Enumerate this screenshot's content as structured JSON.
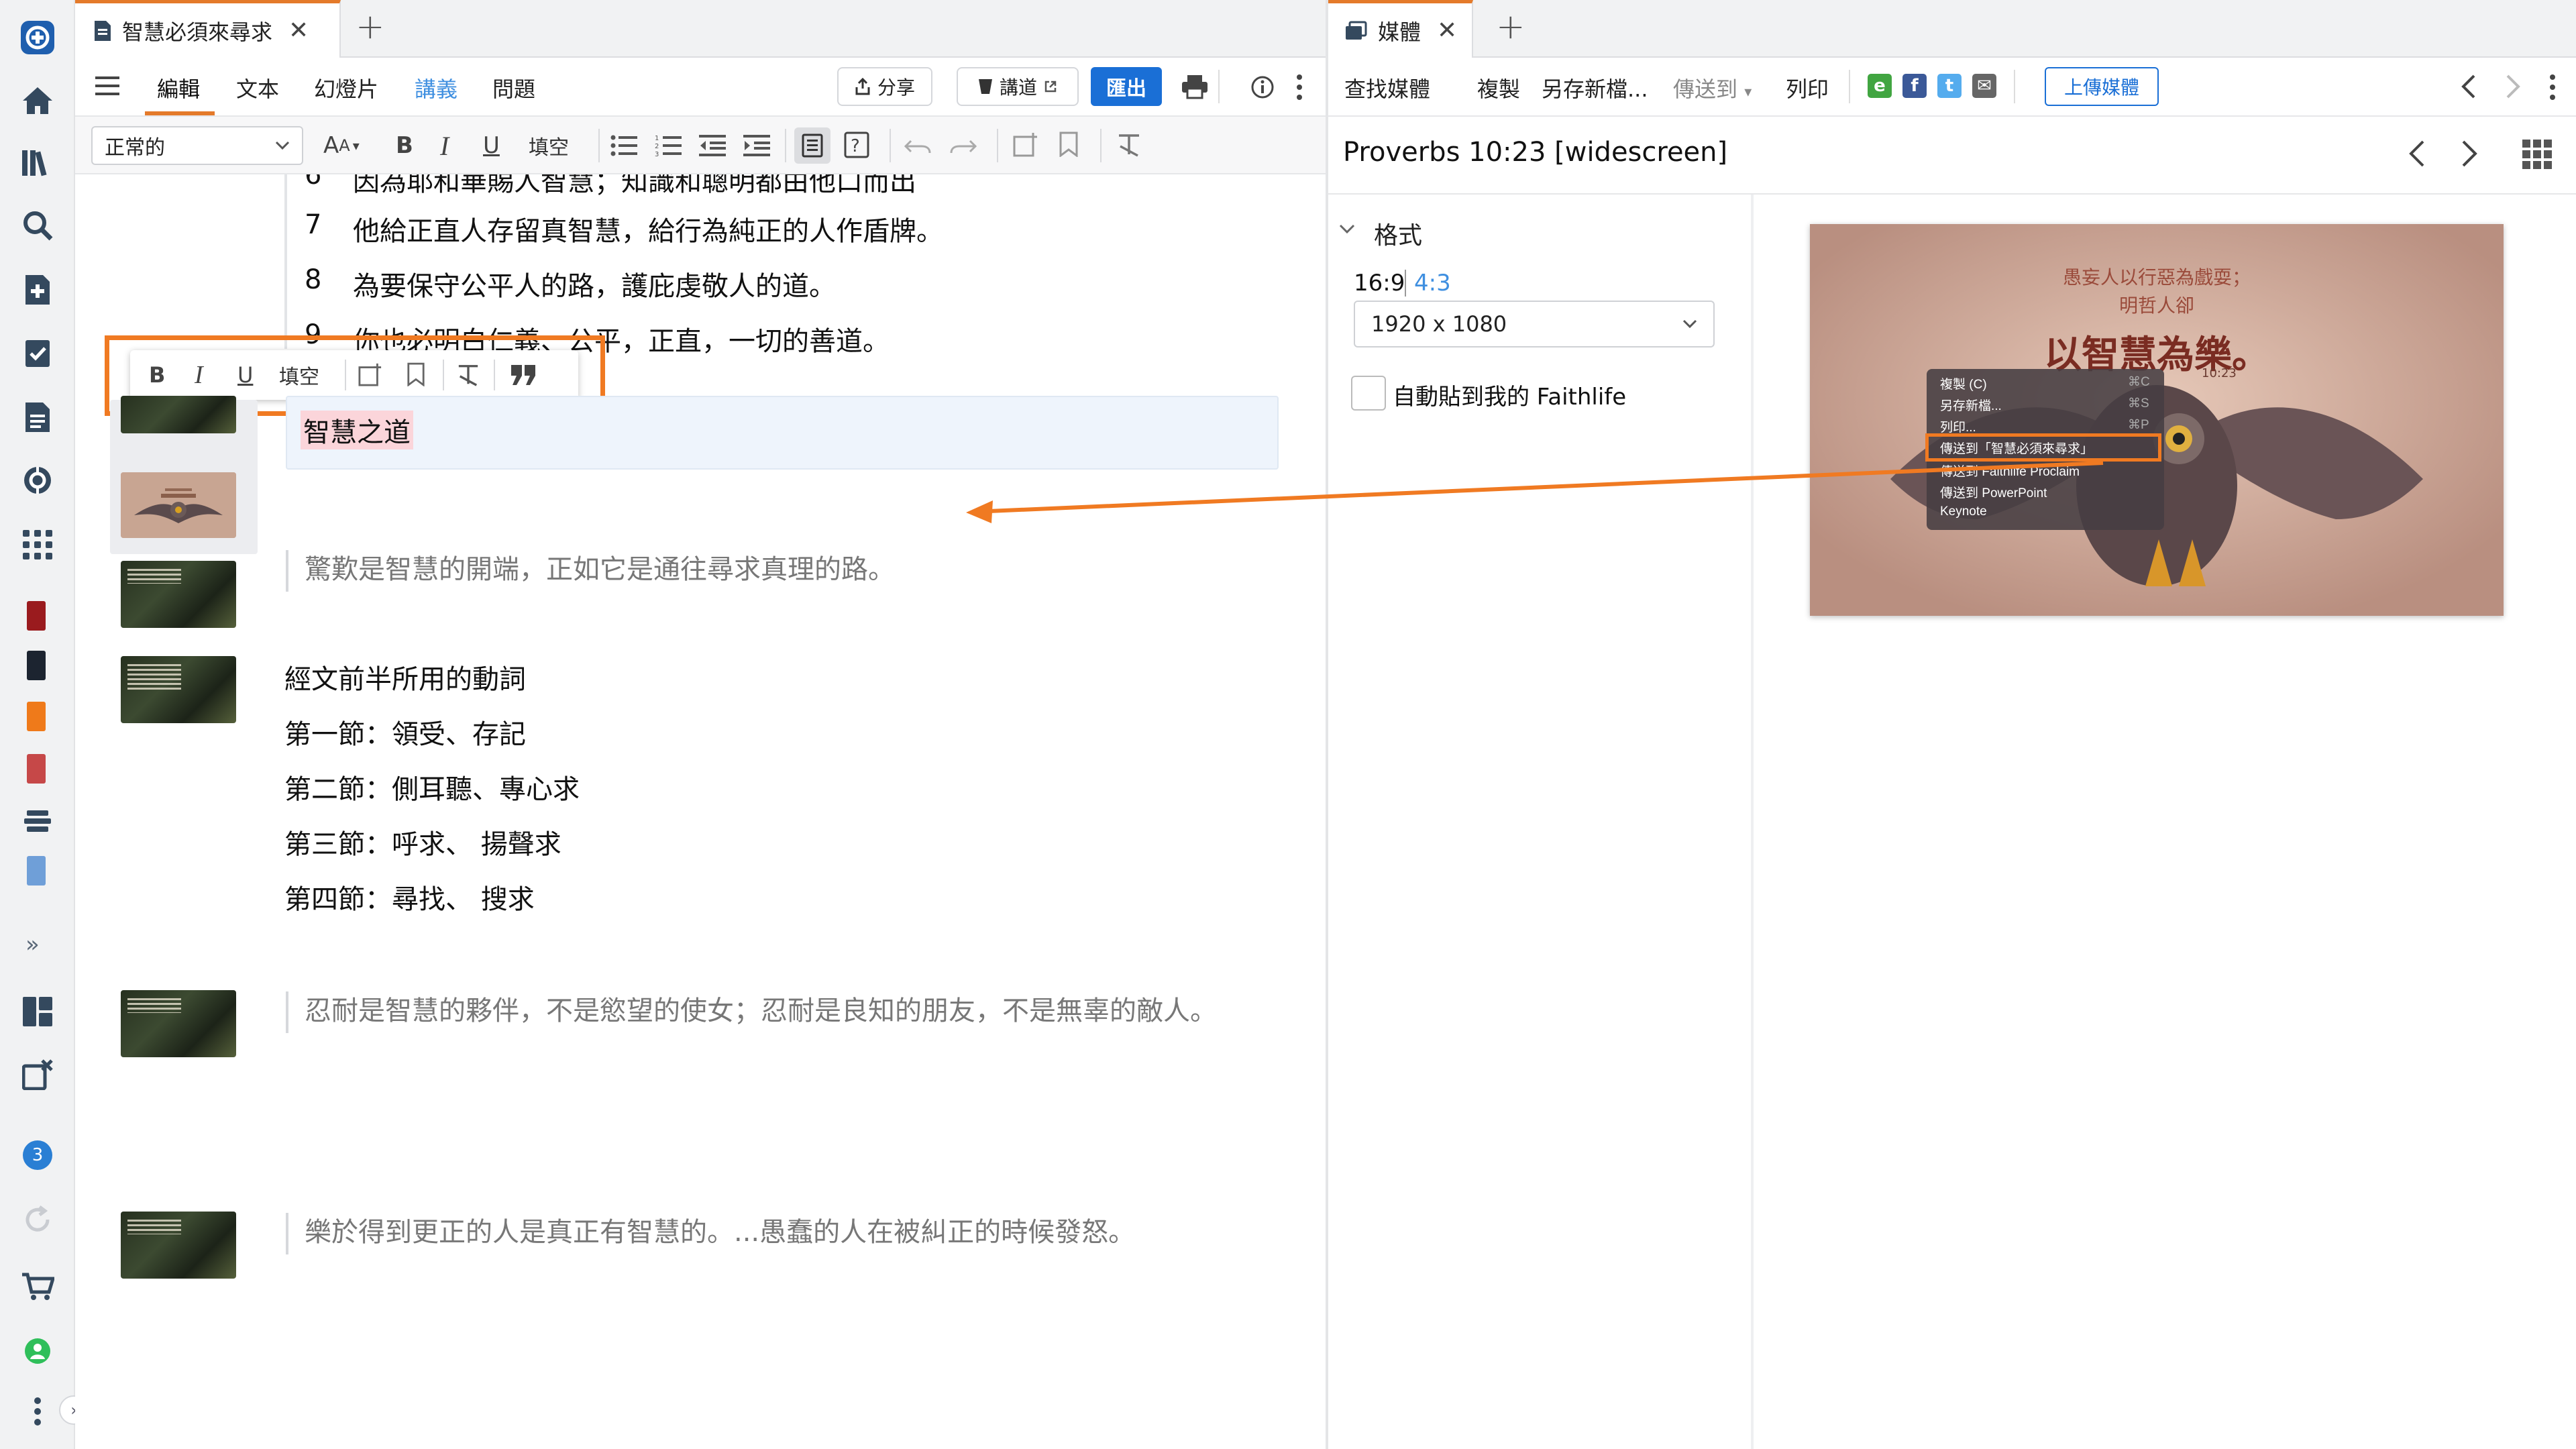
{
  "left_tab": {
    "title": "智慧必須來尋求",
    "close": "✕",
    "new_tab": "+"
  },
  "right_tab": {
    "title": "媒體",
    "close": "✕",
    "new_tab": "+"
  },
  "rail": {
    "badge_count": "3",
    "expand": "»"
  },
  "doc_menu": {
    "items": [
      "編輯",
      "文本",
      "幻燈片",
      "講義",
      "問題"
    ],
    "share": "分享",
    "sermon": "講道",
    "export": "匯出"
  },
  "format_bar": {
    "style_value": "正常的",
    "font_size": "A",
    "bold": "B",
    "italic": "I",
    "underline": "U",
    "blank": "填空"
  },
  "floating_toolbar": {
    "bold": "B",
    "italic": "I",
    "underline": "U",
    "blank": "填空"
  },
  "document": {
    "partial_line": "因為耶和華賜人智慧；知識和聰明都由他口而出",
    "partial_num": "6",
    "verses": [
      {
        "num": "7",
        "text": "他給正直人存留真智慧，給行為純正的人作盾牌。"
      },
      {
        "num": "8",
        "text": "為要保守公平人的路，護庇虔敬人的道。"
      },
      {
        "num": "9",
        "text": "你也必明白仁義、公平，正直，一切的善道。"
      }
    ],
    "selected_heading": "智慧之道",
    "quote1": "驚歎是智慧的開端，正如它是通往尋求真理的路。",
    "block_title": "經文前半所用的動詞",
    "block_lines": [
      "第一節：領受、存記",
      "第二節：側耳聽、專心求",
      "第三節：呼求、 揚聲求",
      "第四節：尋找、 搜求"
    ],
    "quote2": "忍耐是智慧的夥伴，不是慾望的使女；忍耐是良知的朋友，不是無辜的敵人。",
    "quote3": "樂於得到更正的人是真正有智慧的。...愚蠢的人在被糾正的時候發怒。"
  },
  "media_menu": {
    "find": "查找媒體",
    "copy": "複製",
    "save_new": "另存新檔...",
    "send_to": "傳送到",
    "print": "列印",
    "upload": "上傳媒體"
  },
  "media": {
    "title": "Proverbs 10:23 [widescreen]",
    "format_label": "格式",
    "ratio_169": "16:9",
    "ratio_43": "4:3",
    "resolution": "1920 x 1080",
    "autopost": "自動貼到我的 Faithlife"
  },
  "slide": {
    "line1": "愚妄人以行惡為戲耍；",
    "line2": "明哲人卻",
    "line3": "以智慧為樂。",
    "ref": "10:23"
  },
  "context_menu": [
    {
      "label": "複製 (C)",
      "shortcut": "⌘C"
    },
    {
      "label": "另存新檔...",
      "shortcut": "⌘S"
    },
    {
      "label": "列印...",
      "shortcut": "⌘P"
    },
    {
      "label": "傳送到「智慧必須來尋求」",
      "shortcut": ""
    },
    {
      "label": "傳送到 Faithlife Proclaim",
      "shortcut": ""
    },
    {
      "label": "傳送到 PowerPoint",
      "shortcut": ""
    },
    {
      "label": "Keynote",
      "shortcut": ""
    }
  ],
  "colors": {
    "accent_orange": "#f07a22",
    "brand_blue": "#1a6fd6",
    "link_blue": "#3f8fe0"
  }
}
